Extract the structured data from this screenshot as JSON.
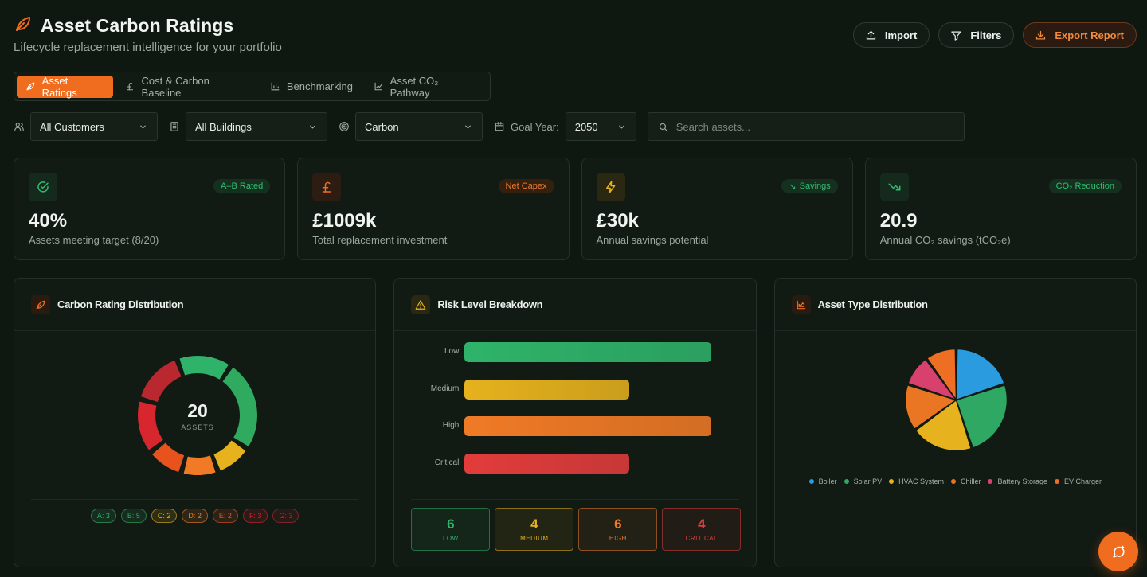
{
  "header": {
    "title": "Asset Carbon Ratings",
    "subtitle": "Lifecycle replacement intelligence for your portfolio",
    "actions": [
      {
        "label": "Import",
        "icon": "upload-icon"
      },
      {
        "label": "Filters",
        "icon": "filter-icon"
      },
      {
        "label": "Export Report",
        "icon": "download-icon"
      }
    ]
  },
  "tabs": [
    {
      "label": "Asset Ratings",
      "icon": "leaf-icon",
      "active": true
    },
    {
      "label": "Cost & Carbon Baseline",
      "icon": "pound-icon",
      "active": false
    },
    {
      "label": "Benchmarking",
      "icon": "bar-chart-icon",
      "active": false
    },
    {
      "label": "Asset CO₂ Pathway",
      "icon": "line-chart-icon",
      "active": false
    }
  ],
  "filters": {
    "customer": "All Customers",
    "building": "All Buildings",
    "metric": "Carbon",
    "goal_label": "Goal Year:",
    "goal_year": "2050",
    "search_placeholder": "Search assets..."
  },
  "kpis": [
    {
      "value": "40%",
      "label": "Assets meeting target (8/20)",
      "badge": "A–B Rated",
      "icon": "check-circle-icon",
      "color": "#2fbf71"
    },
    {
      "value": "£1009k",
      "label": "Total replacement investment",
      "badge": "Net Capex",
      "icon": "pound-icon",
      "color": "#f06d1f"
    },
    {
      "value": "£30k",
      "label": "Annual savings potential",
      "badge": "Savings",
      "icon": "lightning-icon",
      "color": "#e6b21d"
    },
    {
      "value": "20.9",
      "label": "Annual CO₂ savings (tCO₂e)",
      "badge": "CO₂ Reduction",
      "icon": "trending-down-icon",
      "color": "#2fbf71"
    }
  ],
  "rating_panel": {
    "title": "Carbon Rating Distribution",
    "total": "20",
    "total_label": "ASSETS",
    "ratings": [
      {
        "label": "A: 3",
        "count": 3,
        "color": "#2fb36a"
      },
      {
        "label": "B: 5",
        "count": 5,
        "color": "#2faa5e"
      },
      {
        "label": "C: 2",
        "count": 2,
        "color": "#e6b21d"
      },
      {
        "label": "D: 2",
        "count": 2,
        "color": "#f07a26"
      },
      {
        "label": "E: 2",
        "count": 2,
        "color": "#e8521d"
      },
      {
        "label": "F: 3",
        "count": 3,
        "color": "#d7262e"
      },
      {
        "label": "G: 3",
        "count": 3,
        "color": "#b9272f"
      }
    ]
  },
  "risk_panel": {
    "title": "Risk Level Breakdown",
    "levels": [
      {
        "label": "Low",
        "value": 6,
        "color": "#2fb36a",
        "card_label": "LOW"
      },
      {
        "label": "Medium",
        "value": 4,
        "color": "#e6b21d",
        "card_label": "MEDIUM"
      },
      {
        "label": "High",
        "value": 6,
        "color": "#f07a26",
        "card_label": "HIGH"
      },
      {
        "label": "Critical",
        "value": 4,
        "color": "#e23c3c",
        "card_label": "CRITICAL"
      }
    ]
  },
  "asset_panel": {
    "title": "Asset Type Distribution",
    "types": [
      {
        "name": "Boiler",
        "value": 4,
        "color": "#2b9be0"
      },
      {
        "name": "Solar PV",
        "value": 5,
        "color": "#2fa863"
      },
      {
        "name": "HVAC System",
        "value": 4,
        "color": "#e6b21d"
      },
      {
        "name": "Chiller",
        "value": 3,
        "color": "#ea7624"
      },
      {
        "name": "Battery Storage",
        "value": 2,
        "color": "#d8416e"
      },
      {
        "name": "EV Charger",
        "value": 2,
        "color": "#ee6f23"
      }
    ]
  }
}
